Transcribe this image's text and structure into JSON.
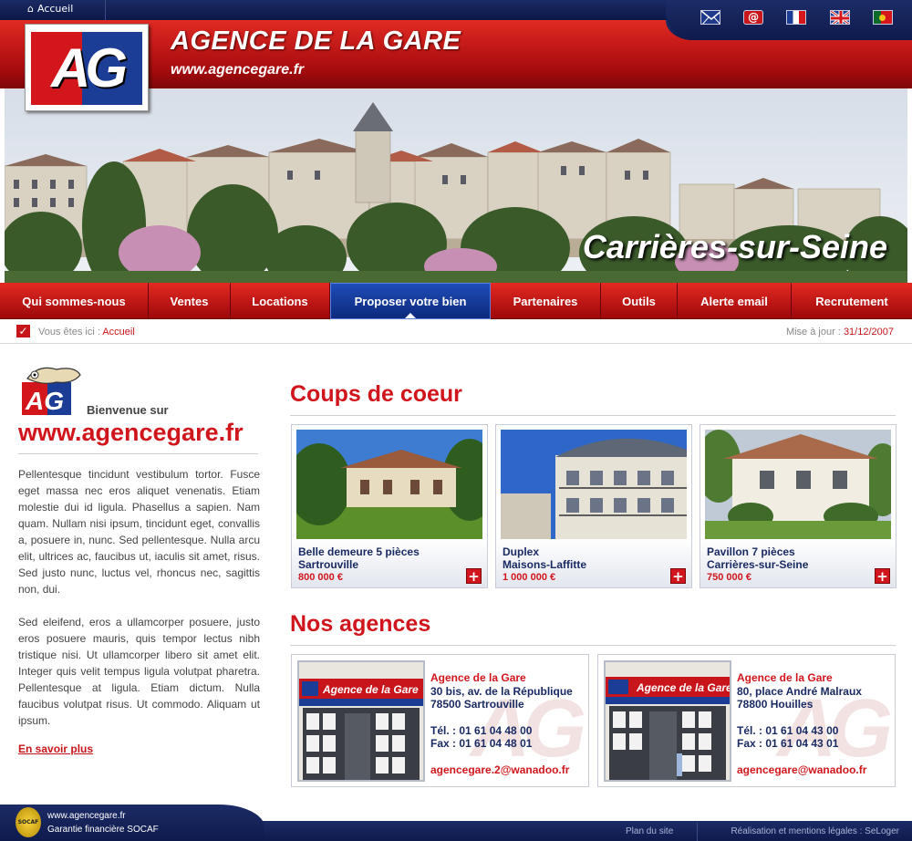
{
  "topbar": {
    "home_label": "Accueil",
    "icons": [
      "mail-icon",
      "at-email-icon",
      "flag-fr-icon",
      "flag-uk-icon",
      "flag-pt-icon"
    ]
  },
  "header": {
    "logo_text": "AG",
    "title": "AGENCE DE LA GARE",
    "url": "www.agencegare.fr"
  },
  "banner": {
    "caption": "Carrières-sur-Seine"
  },
  "nav": {
    "items": [
      {
        "label": "Qui sommes-nous"
      },
      {
        "label": "Ventes"
      },
      {
        "label": "Locations"
      },
      {
        "label": "Proposer votre bien",
        "active": true
      },
      {
        "label": "Partenaires"
      },
      {
        "label": "Outils"
      },
      {
        "label": "Alerte email"
      },
      {
        "label": "Recrutement"
      }
    ]
  },
  "breadcrumb": {
    "prefix": "Vous êtes ici :",
    "current": "Accueil",
    "update_label": "Mise à jour :",
    "update_date": "31/12/2007"
  },
  "left": {
    "welcome": "Bienvenue sur",
    "url": "www.agencegare.fr",
    "para1": "Pellentesque tincidunt vestibulum tortor. Fusce eget massa nec eros aliquet venenatis. Etiam molestie dui id ligula. Phasellus a sapien. Nam quam. Nullam nisi ipsum, tincidunt eget, convallis a, posuere in, nunc. Sed pellentesque. Nulla arcu elit, ultrices ac, faucibus ut, iaculis sit amet, risus. Sed justo nunc, luctus vel, rhoncus nec, sagittis non, dui.",
    "para2": "Sed eleifend, eros a ullamcorper posuere, justo eros posuere mauris, quis tempor lectus nibh tristique nisi. Ut ullamcorper libero sit amet elit. Integer quis velit tempus ligula volutpat pharetra. Pellentesque at ligula. Etiam dictum. Nulla faucibus volutpat risus. Ut commodo. Aliquam ut ipsum.",
    "more_label": "En savoir plus"
  },
  "featured": {
    "title": "Coups de coeur",
    "cards": [
      {
        "line1": "Belle demeure 5 pièces",
        "line2": "Sartrouville",
        "price": "800 000 €"
      },
      {
        "line1": "Duplex",
        "line2": "Maisons-Laffitte",
        "price": "1 000 000 €"
      },
      {
        "line1": "Pavillon 7 pièces",
        "line2": "Carrières-sur-Seine",
        "price": "750 000 €"
      }
    ]
  },
  "agencies": {
    "title": "Nos agences",
    "list": [
      {
        "name": "Agence de la Gare",
        "street": "30 bis, av. de la République",
        "city": "78500 Sartrouville",
        "tel": "Tél. : 01 61 04 48 00",
        "fax": "Fax : 01 61 04 48 01",
        "email": "agencegare.2@wanadoo.fr",
        "sign": "Agence de la Gare"
      },
      {
        "name": "Agence de la Gare",
        "street": "80, place André Malraux",
        "city": "78800 Houilles",
        "tel": "Tél. : 01 61 04 43 00",
        "fax": "Fax : 01 61 04 43 01",
        "email": "agencegare@wanadoo.fr",
        "sign": "Agence de la Gare"
      }
    ]
  },
  "footer": {
    "url": "www.agencegare.fr",
    "guarantee": "Garantie financière SOCAF",
    "badge": "SOCAF",
    "sitemap": "Plan du site",
    "legal": "Réalisation et mentions légales : SeLoger"
  },
  "colors": {
    "brand_red": "#d0161c",
    "navy": "#1a2a63",
    "active_blue": "#1f4cb8"
  }
}
